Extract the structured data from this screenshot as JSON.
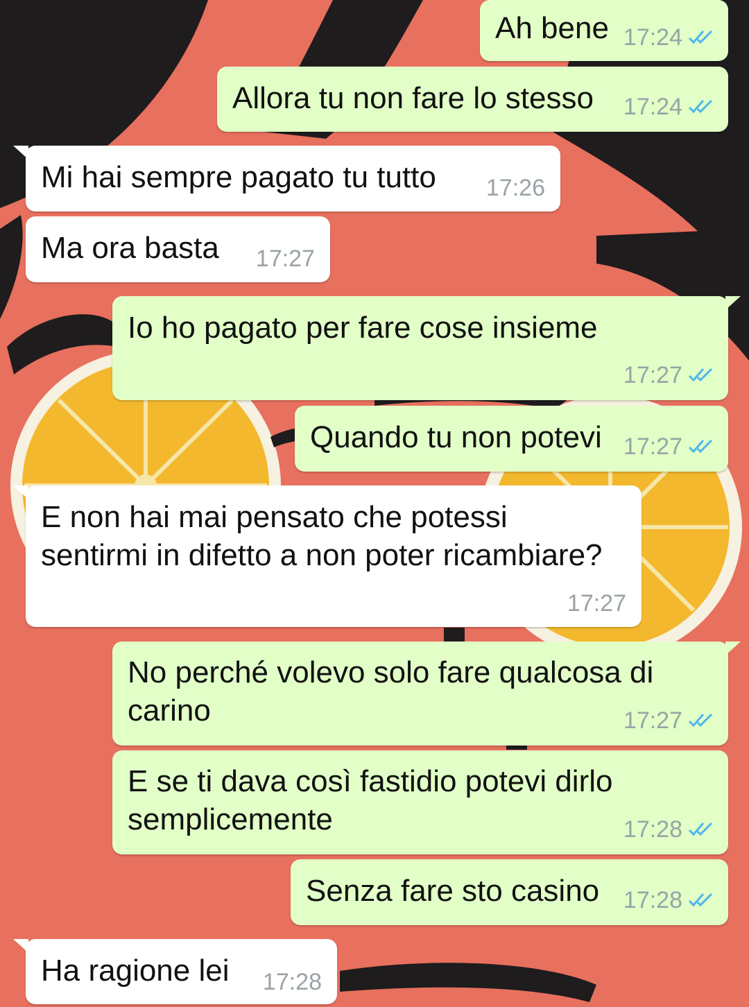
{
  "messages": [
    {
      "direction": "out",
      "text": "Ah bene",
      "time": "17:24",
      "status": "read-double-check-icon"
    },
    {
      "direction": "out",
      "text": "Allora tu non fare lo stesso",
      "time": "17:24",
      "status": "read-double-check-icon"
    },
    {
      "direction": "in",
      "text": "Mi hai sempre pagato tu tutto",
      "time": "17:26"
    },
    {
      "direction": "in",
      "text": "Ma ora basta",
      "time": "17:27"
    },
    {
      "direction": "out",
      "text": "Io ho pagato per fare cose insieme",
      "time": "17:27",
      "status": "read-double-check-icon"
    },
    {
      "direction": "out",
      "text": "Quando tu non potevi",
      "time": "17:27",
      "status": "read-double-check-icon"
    },
    {
      "direction": "in",
      "text_lines": [
        "E non hai mai pensato che potessi",
        "sentirmi in difetto a non poter ricambiare?"
      ],
      "time": "17:27"
    },
    {
      "direction": "out",
      "text_lines": [
        "No perché volevo solo fare qualcosa di",
        "carino"
      ],
      "time": "17:27",
      "status": "read-double-check-icon"
    },
    {
      "direction": "out",
      "text_lines": [
        "E se ti dava così fastidio potevi dirlo",
        "semplicemente"
      ],
      "time": "17:28",
      "status": "read-double-check-icon"
    },
    {
      "direction": "out",
      "text": "Senza fare sto casino",
      "time": "17:28",
      "status": "read-double-check-icon"
    },
    {
      "direction": "in",
      "text": "Ha ragione lei",
      "time": "17:28"
    }
  ],
  "colors": {
    "outgoing_bubble": "#e1ffc7",
    "incoming_bubble": "#ffffff",
    "timestamp": "#9aa3a6",
    "read_ticks": "#4fb6ec",
    "wallpaper_background": "#e8705e",
    "wallpaper_dark": "#1e1c1d",
    "wallpaper_lemon": "#f4b82e"
  }
}
